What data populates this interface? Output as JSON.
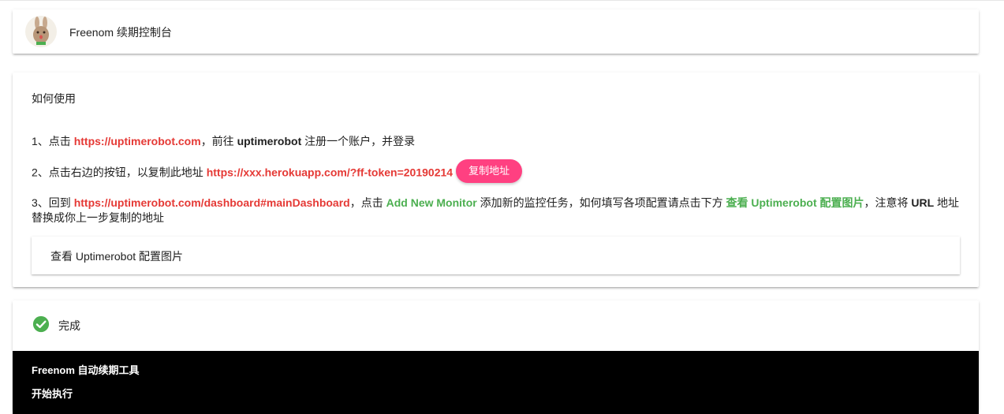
{
  "header": {
    "title": "Freenom 续期控制台"
  },
  "usage": {
    "heading": "如何使用",
    "step1": {
      "prefix": "1、点击 ",
      "link": "https://uptimerobot.com",
      "middle": "，前往 ",
      "bold": "uptimerobot",
      "suffix": " 注册一个账户，并登录"
    },
    "step2": {
      "prefix": "2、点击右边的按钮，以复制此地址 ",
      "link": "https://xxx.herokuapp.com/?ff-token=20190214",
      "button_label": "复制地址"
    },
    "step3": {
      "prefix": "3、回到 ",
      "link": "https://uptimerobot.com/dashboard#mainDashboard",
      "middle1": "，点击 ",
      "action": "Add New Monitor",
      "middle2": " 添加新的监控任务，如何填写各项配置请点击下方 ",
      "view_link": "查看 Uptimerobot 配置图片",
      "middle3": "，注意将 ",
      "bold": "URL",
      "suffix": " 地址替换成你上一步复制的地址"
    },
    "expander_label": "查看 Uptimerobot 配置图片"
  },
  "status": {
    "label": "完成",
    "console": [
      "Freenom 自动续期工具",
      "开始执行"
    ]
  },
  "colors": {
    "accent_pink": "#ff4081",
    "link_red": "#e53935",
    "success_green": "#4caf50"
  },
  "icons": {
    "avatar": "rabbit-avatar",
    "status": "check-circle-icon"
  }
}
